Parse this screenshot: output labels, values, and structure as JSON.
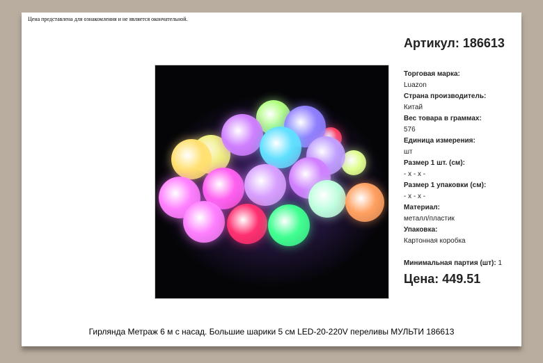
{
  "notice": "Цена представлена для ознакомления и не является окончательной.",
  "sku": "Артикул: 186613",
  "specs": [
    {
      "label": "Торговая марка:",
      "value": "Luazon"
    },
    {
      "label": "Страна производитель:",
      "value": "Китай"
    },
    {
      "label": "Вес товара в граммах:",
      "value": "576"
    },
    {
      "label": "Единица измерения:",
      "value": "шт"
    },
    {
      "label": "Размер 1 шт. (см):",
      "value": "- x - x -"
    },
    {
      "label": "Размер 1 упаковки (см):",
      "value": "- x - x -"
    },
    {
      "label": "Материал:",
      "value": "металл/пластик"
    },
    {
      "label": "Упаковка:",
      "value": "Картонная коробка"
    }
  ],
  "min_label": "Минимальная партия (шт):",
  "min_value": "1",
  "price": "Цена: 449.51",
  "product_title": "Гирлянда Метраж 6 м с насад. Большие шарики 5 см LED-20-220V переливы МУЛЬТИ 186613",
  "balls": [
    [
      "#f0f080",
      80,
      128,
      28
    ],
    [
      "#b0ff80",
      170,
      75,
      25
    ],
    [
      "#ff4060",
      252,
      105,
      16
    ],
    [
      "#e0ff90",
      285,
      140,
      18
    ],
    [
      "#d080ff",
      125,
      100,
      30
    ],
    [
      "#9080ff",
      215,
      88,
      30
    ],
    [
      "#60e0ff",
      180,
      118,
      30
    ],
    [
      "#c0a0ff",
      245,
      130,
      28
    ],
    [
      "#ffe070",
      52,
      135,
      29
    ],
    [
      "#ff80ff",
      35,
      190,
      30
    ],
    [
      "#ff60f0",
      98,
      177,
      30
    ],
    [
      "#d8a0ff",
      158,
      172,
      30
    ],
    [
      "#d080ff",
      222,
      162,
      30
    ],
    [
      "#c0ffe0",
      247,
      192,
      27
    ],
    [
      "#ffa060",
      301,
      197,
      28
    ],
    [
      "#ff80ff",
      70,
      225,
      30
    ],
    [
      "#ff3070",
      132,
      228,
      29
    ],
    [
      "#40ff90",
      192,
      230,
      30
    ]
  ]
}
